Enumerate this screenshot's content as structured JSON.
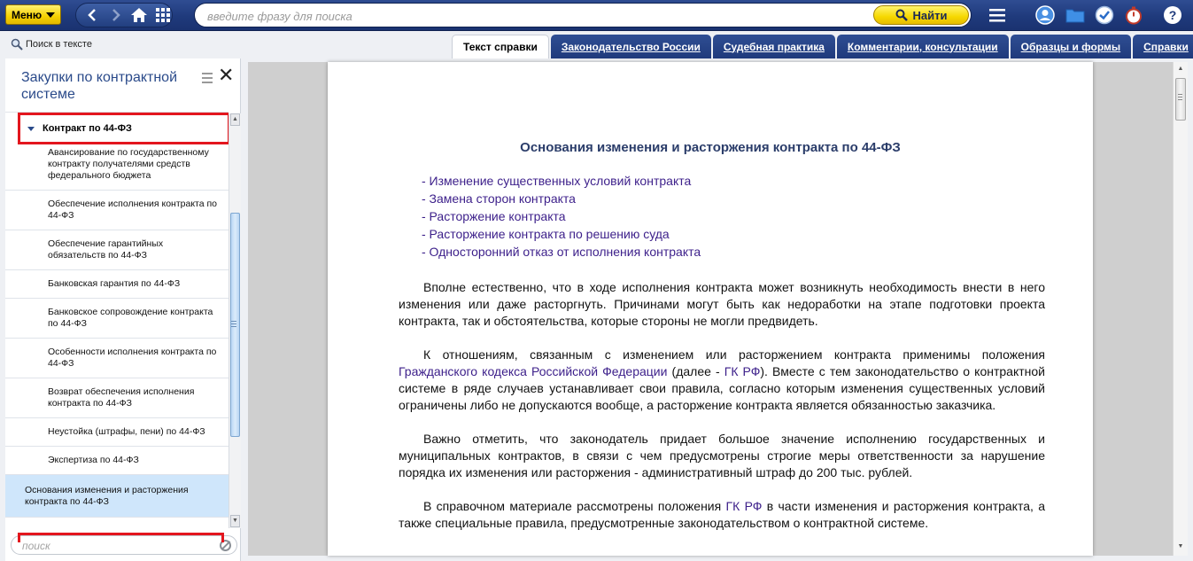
{
  "toolbar": {
    "menu_label": "Меню",
    "search_placeholder": "введите фразу для поиска",
    "find_label": "Найти",
    "icons": [
      "back-icon",
      "forward-icon",
      "home-icon",
      "grid-icon",
      "hamburger-icon",
      "user-icon",
      "folder-icon",
      "clock-check-icon",
      "timer-icon",
      "help-icon"
    ]
  },
  "subbar": {
    "search_in_text": "Поиск в тексте",
    "tabs": [
      {
        "label": "Текст справки",
        "active": true
      },
      {
        "label": "Законодательство России",
        "active": false
      },
      {
        "label": "Судебная практика",
        "active": false
      },
      {
        "label": "Комментарии, консультации",
        "active": false
      },
      {
        "label": "Образцы и формы",
        "active": false
      },
      {
        "label": "Справки",
        "active": false
      }
    ]
  },
  "left_panel": {
    "title": "Закупки по контрактной системе",
    "section": "Контракт по 44-ФЗ",
    "items": [
      "Авансирование по государственному контракту получателями средств федерального бюджета",
      "Обеспечение исполнения контракта по 44-ФЗ",
      "Обеспечение гарантийных обязательств по 44-ФЗ",
      "Банковская гарантия по 44-ФЗ",
      "Банковское сопровождение контракта по 44-ФЗ",
      "Особенности исполнения контракта по 44-ФЗ",
      "Возврат обеспечения исполнения контракта по 44-ФЗ",
      "Неустойка (штрафы, пени) по 44-ФЗ",
      "Экспертиза по 44-ФЗ",
      "Основания изменения и расторжения контракта по 44-ФЗ"
    ],
    "selected_index": 9,
    "search_placeholder": "поиск"
  },
  "document": {
    "title": "Основания изменения и расторжения контракта по 44-ФЗ",
    "toc": [
      "- Изменение существенных условий контракта",
      "- Замена сторон контракта",
      "- Расторжение контракта",
      "- Расторжение контракта по решению суда",
      "- Односторонний отказ от исполнения контракта"
    ],
    "p1": "Вполне естественно, что в ходе исполнения контракта может возникнуть необходимость внести в него изменения или даже расторгнуть. Причинами могут быть как недоработки на этапе подготовки проекта контракта, так и обстоятельства, которые стороны не могли предвидеть.",
    "p2": {
      "a": "К отношениям, связанным с изменением или расторжением контракта применимы положения ",
      "link1": "Гражданского кодекса Российской Федерации",
      "b": " (далее - ",
      "link2": "ГК РФ",
      "c": "). Вместе с тем законодательство о контрактной системе в ряде случаев устанавливает свои правила, согласно которым изменения существенных условий ограничены либо не допускаются вообще, а расторжение контракта является обязанностью заказчика."
    },
    "p3": "Важно отметить, что законодатель придает большое значение исполнению государственных и муниципальных контрактов, в связи с чем предусмотрены строгие меры ответственности за нарушение порядка их изменения или расторжения - административный штраф до 200 тыс. рублей.",
    "p4": {
      "a": "В справочном материале рассмотрены положения ",
      "link": "ГК РФ",
      "b": " в части изменения и расторжения контракта, а также специальные правила, предусмотренные законодательством о контрактной системе."
    }
  }
}
